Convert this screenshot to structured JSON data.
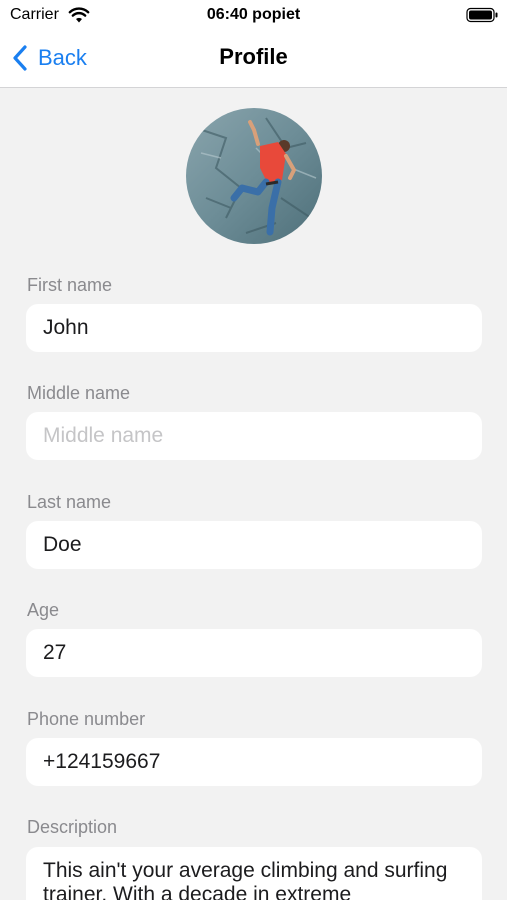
{
  "status_bar": {
    "carrier": "Carrier",
    "time": "06:40 popiet",
    "wifi_icon": "wifi-icon",
    "battery_icon": "battery-icon"
  },
  "nav": {
    "back_label": "Back",
    "back_icon": "chevron-left-icon",
    "title": "Profile"
  },
  "accent_color": "#1a7ff0",
  "avatar": {
    "description_icon": "avatar-photo"
  },
  "form": {
    "first_name": {
      "label": "First name",
      "value": "John",
      "placeholder": "First name"
    },
    "middle_name": {
      "label": "Middle name",
      "value": "",
      "placeholder": "Middle name"
    },
    "last_name": {
      "label": "Last name",
      "value": "Doe",
      "placeholder": "Last name"
    },
    "age": {
      "label": "Age",
      "value": "27",
      "placeholder": "Age"
    },
    "phone": {
      "label": "Phone number",
      "value": "+124159667",
      "placeholder": "Phone number"
    },
    "description": {
      "label": "Description",
      "value": "This ain't your average climbing and surfing trainer. With a decade in extreme"
    }
  }
}
